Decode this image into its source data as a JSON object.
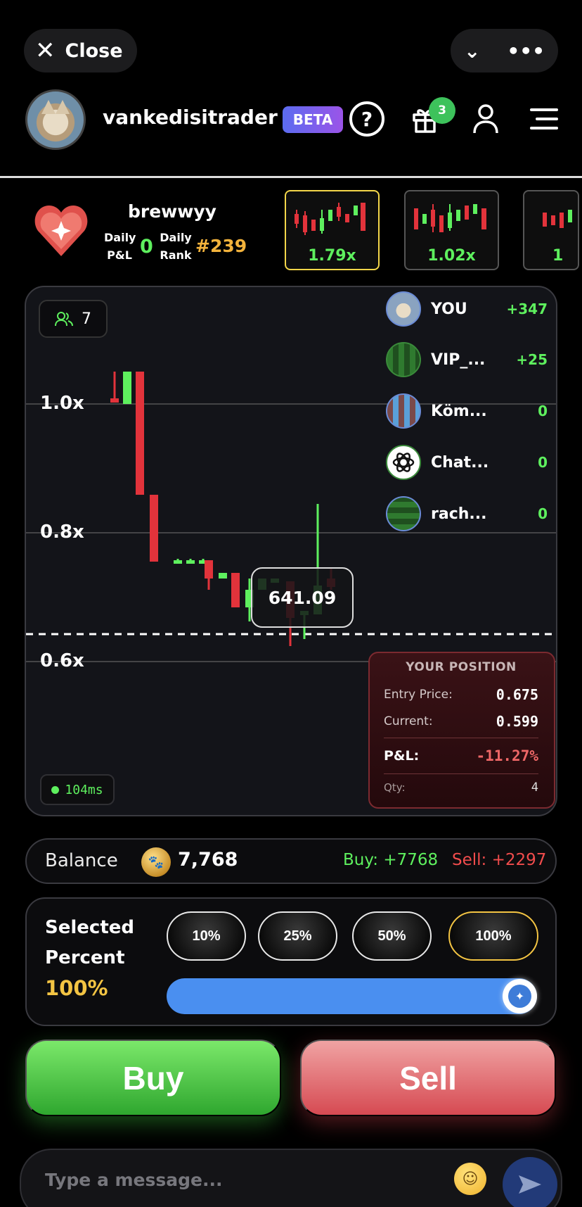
{
  "topbar": {
    "close_label": "Close"
  },
  "header": {
    "username": "vankedisitrader",
    "beta_label": "BETA",
    "help_glyph": "?",
    "gift_count": "3"
  },
  "game": {
    "player": "brewwyy",
    "daily_pl_label": "Daily P&L",
    "daily_pl_value": "0",
    "daily_rank_label": "Daily Rank",
    "daily_rank_value": "#239",
    "cards": [
      {
        "multiplier": "1.79x",
        "active": true
      },
      {
        "multiplier": "1.02x",
        "active": false
      },
      {
        "multiplier": "1",
        "active": false
      }
    ]
  },
  "chart": {
    "players_count": "7",
    "y_labels": [
      "1.0x",
      "0.8x",
      "0.6x"
    ],
    "current_price": "641.09",
    "latency": "104ms",
    "leaderboard": [
      {
        "name": "YOU",
        "score": "+347"
      },
      {
        "name": "VIP_...",
        "score": "+25"
      },
      {
        "name": "Köm...",
        "score": "0"
      },
      {
        "name": "Chat...",
        "score": "0"
      },
      {
        "name": "rach...",
        "score": "0"
      }
    ],
    "position": {
      "title": "YOUR POSITION",
      "entry_label": "Entry Price:",
      "entry_value": "0.675",
      "current_label": "Current:",
      "current_value": "0.599",
      "pl_label": "P&L:",
      "pl_value": "-11.27%",
      "qty_label": "Qty:",
      "qty_value": "4"
    }
  },
  "balance": {
    "label": "Balance",
    "value": "7,768",
    "buy": "Buy: +7768",
    "sell": "Sell: +2297"
  },
  "percent": {
    "label_line1": "Selected",
    "label_line2": "Percent",
    "value": "100%",
    "options": [
      "10%",
      "25%",
      "50%",
      "100%"
    ],
    "selected": "100%",
    "slider_fraction": 1.0
  },
  "actions": {
    "buy_label": "Buy",
    "sell_label": "Sell"
  },
  "chat": {
    "placeholder": "Type a message..."
  },
  "colors": {
    "green": "#5ef05e",
    "red": "#e2333b",
    "gold": "#f3c443",
    "slider": "#4a8ff0"
  }
}
